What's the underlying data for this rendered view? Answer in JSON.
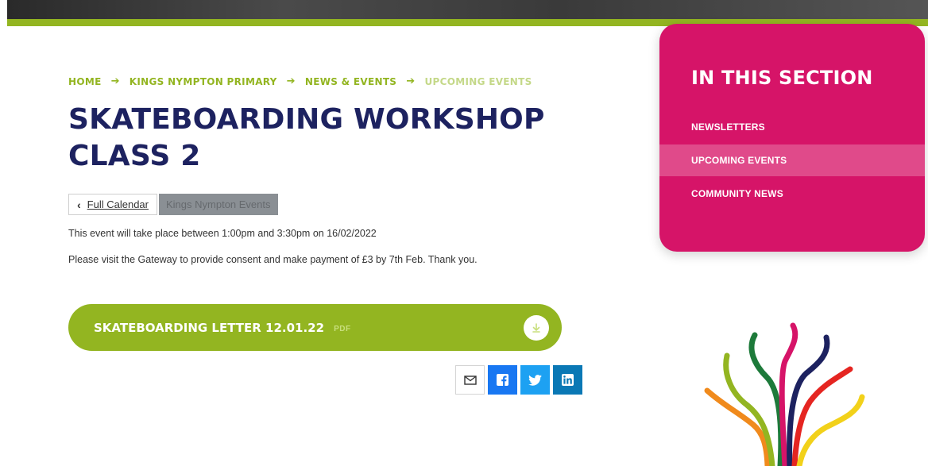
{
  "breadcrumb": {
    "items": [
      "HOME",
      "KINGS NYMPTON PRIMARY",
      "NEWS & EVENTS"
    ],
    "current": "UPCOMING EVENTS"
  },
  "page": {
    "title": "SKATEBOARDING WORKSHOP CLASS 2"
  },
  "buttons": {
    "full_calendar": "Full Calendar",
    "event_tag": "Kings Nympton Events"
  },
  "event": {
    "time_text": "This event will take place between 1:00pm and 3:30pm on 16/02/2022",
    "note_text": "Please visit the Gateway to provide consent and make payment of £3 by 7th Feb.  Thank you."
  },
  "download": {
    "title": "SKATEBOARDING LETTER 12.01.22",
    "type": "PDF",
    "icon": "download-icon"
  },
  "share": {
    "icons": [
      "email-icon",
      "facebook-icon",
      "twitter-icon",
      "linkedin-icon"
    ]
  },
  "sidebar": {
    "heading": "IN THIS SECTION",
    "items": [
      {
        "label": "NEWSLETTERS",
        "active": false
      },
      {
        "label": "UPCOMING EVENTS",
        "active": true
      },
      {
        "label": "COMMUNITY NEWS",
        "active": false
      }
    ]
  },
  "colors": {
    "brand_green": "#93b521",
    "brand_navy": "#1d2260",
    "brand_pink": "#d61468",
    "facebook": "#1877f2",
    "twitter": "#1da1f2",
    "linkedin": "#0a78b5"
  }
}
